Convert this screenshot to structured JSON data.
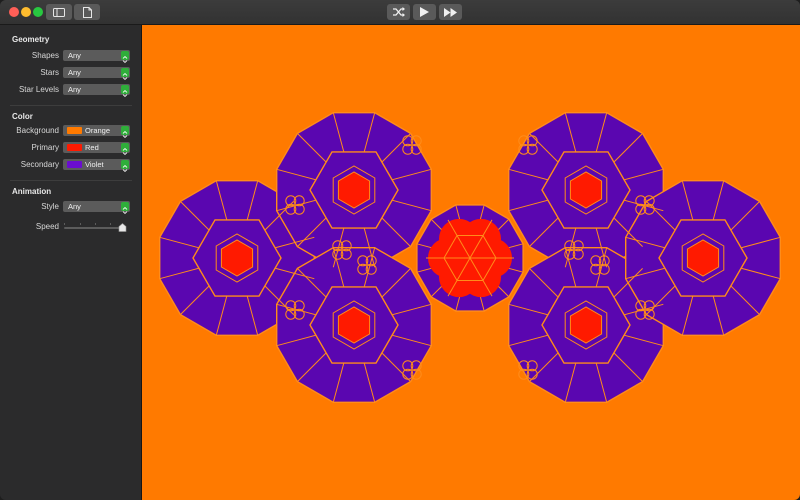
{
  "window": {
    "traffic_lights": [
      {
        "name": "close",
        "color": "#ff5f57"
      },
      {
        "name": "minimize",
        "color": "#febc2e"
      },
      {
        "name": "zoom",
        "color": "#28c840"
      }
    ],
    "toolbar_icons": [
      "sidebar-icon",
      "document-icon",
      "shuffle-icon",
      "play-icon",
      "fast-forward-icon"
    ]
  },
  "sidebar": {
    "geometry": {
      "title": "Geometry",
      "rows": [
        {
          "label": "Shapes",
          "value": "Any"
        },
        {
          "label": "Stars",
          "value": "Any"
        },
        {
          "label": "Star Levels",
          "value": "Any"
        }
      ]
    },
    "color": {
      "title": "Color",
      "rows": [
        {
          "label": "Background",
          "value": "Orange",
          "swatch": "#ff7a00"
        },
        {
          "label": "Primary",
          "value": "Red",
          "swatch": "#ff1a00"
        },
        {
          "label": "Secondary",
          "value": "Violet",
          "swatch": "#6a0dcf"
        }
      ]
    },
    "animation": {
      "title": "Animation",
      "style": {
        "label": "Style",
        "value": "Any"
      },
      "speed": {
        "label": "Speed",
        "level": 0.95
      }
    }
  },
  "canvas": {
    "background": "#ff7a00",
    "primary": "#ff1a00",
    "secondary": "#5a06b0",
    "line": "#ff8c1a"
  }
}
